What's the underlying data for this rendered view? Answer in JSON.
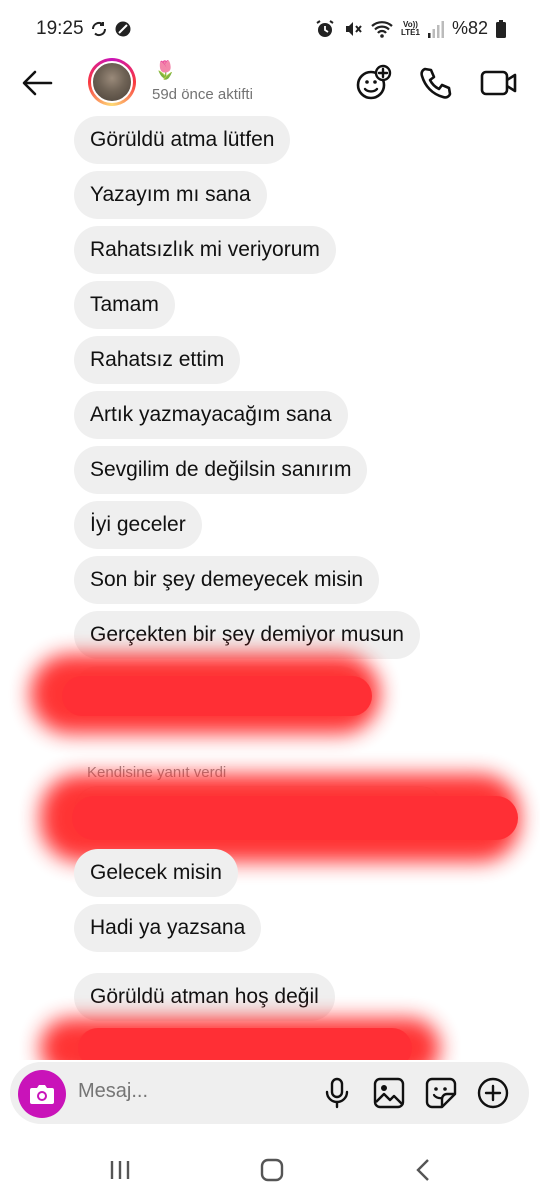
{
  "status_bar": {
    "time": "19:25",
    "battery": "%82",
    "volte_label": "Vo))",
    "lte_label": "LTE1"
  },
  "header": {
    "contact_emoji": "🌷",
    "contact_status": "59d önce aktifti"
  },
  "messages": [
    {
      "text": "Görüldü atma lütfen"
    },
    {
      "text": "Yazayım mı sana"
    },
    {
      "text": "Rahatsızlık mi veriyorum"
    },
    {
      "text": "Tamam"
    },
    {
      "text": "Rahatsız ettim"
    },
    {
      "text": "Artık yazmayacağım sana"
    },
    {
      "text": "Sevgilim de değilsin sanırım"
    },
    {
      "text": "İyi geceler"
    },
    {
      "text": "Son bir şey demeyecek misin"
    },
    {
      "text": "Gerçekten bir şey demiyor musun"
    },
    {
      "text": "Gelecek misin"
    },
    {
      "text": "Hadi ya yazsana"
    },
    {
      "text": "Görüldü atman hoş değil"
    }
  ],
  "reply_note": "Kendisine yanıt verdi",
  "composer": {
    "placeholder": "Mesaj..."
  },
  "colors": {
    "bubble": "#efefef",
    "accent": "#c913b9",
    "redaction": "#ff2a2a"
  },
  "icons": [
    "back-arrow-icon",
    "add-person-icon",
    "phone-icon",
    "video-icon",
    "camera-icon",
    "mic-icon",
    "gallery-icon",
    "sticker-icon",
    "plus-icon"
  ]
}
